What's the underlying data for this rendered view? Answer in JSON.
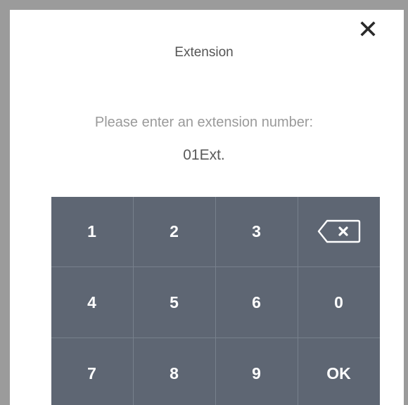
{
  "dialog": {
    "title": "Extension",
    "prompt": "Please enter an extension number:",
    "value": "01Ext.",
    "close_icon": "close-icon"
  },
  "keypad": {
    "keys": [
      "1",
      "2",
      "3",
      "backspace",
      "4",
      "5",
      "6",
      "0",
      "7",
      "8",
      "9",
      "OK"
    ],
    "backspace_icon": "backspace-icon",
    "background_color": "#5e6673",
    "text_color": "#ffffff"
  }
}
